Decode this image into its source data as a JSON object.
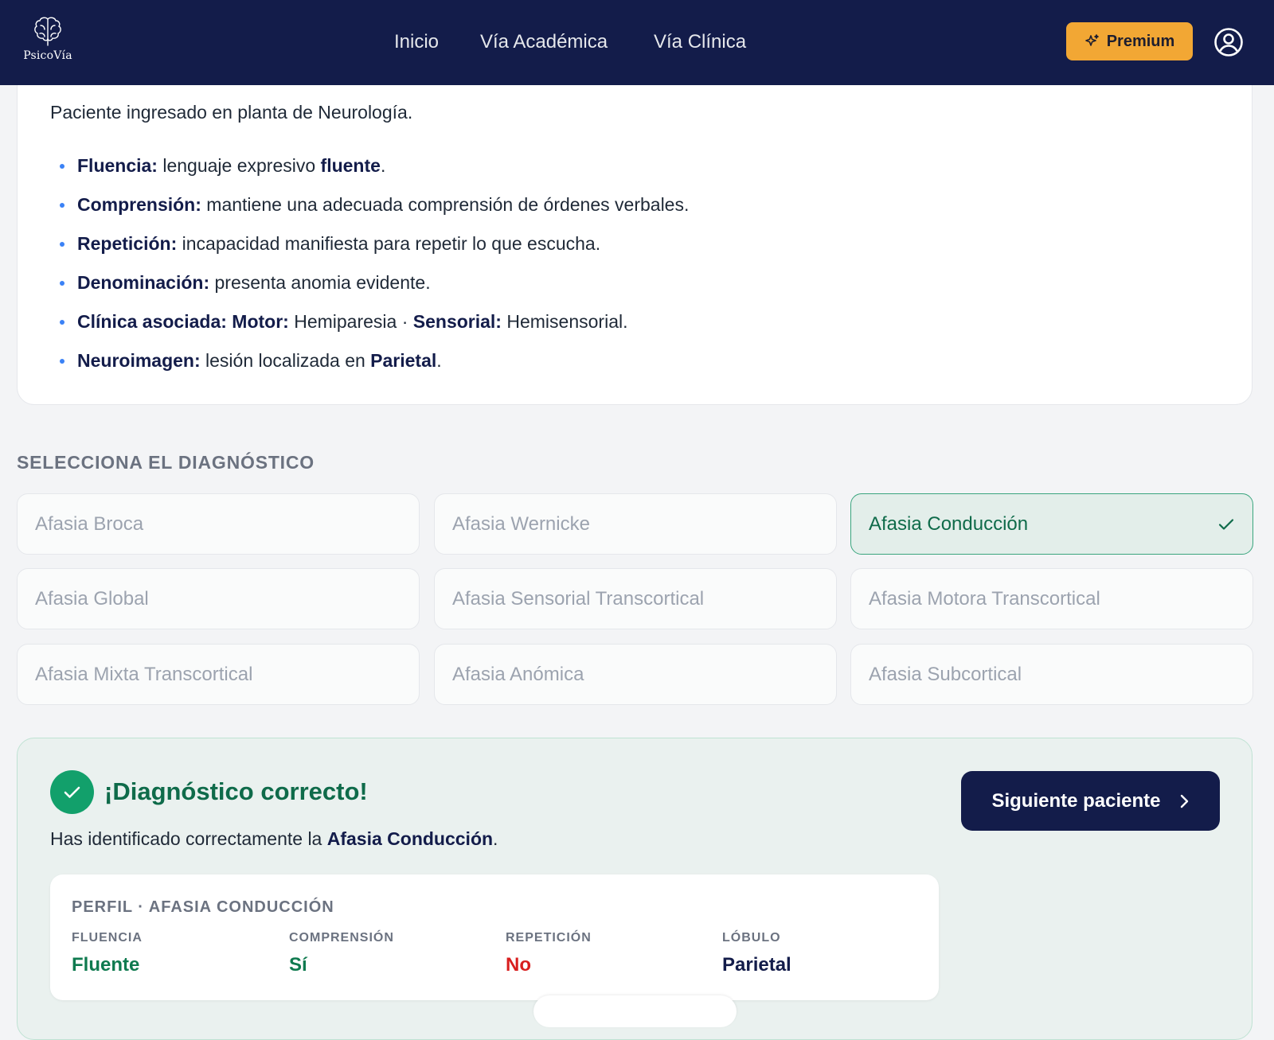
{
  "header": {
    "logo_text": "PsicoVía",
    "nav": [
      "Inicio",
      "Vía Académica",
      "Vía Clínica"
    ],
    "premium_label": "Premium"
  },
  "case": {
    "intro": "Paciente ingresado en planta de Neurología.",
    "items": [
      {
        "label": "Fluencia:",
        "text": " lenguaje expresivo ",
        "strong": "fluente",
        "tail": "."
      },
      {
        "label": "Comprensión:",
        "text": " mantiene una adecuada comprensión de órdenes verbales."
      },
      {
        "label": "Repetición:",
        "text": " incapacidad manifiesta para repetir lo que escucha."
      },
      {
        "label": "Denominación:",
        "text": " presenta anomia evidente."
      },
      {
        "label": "Clínica asociada: Motor:",
        "text": " Hemiparesia · ",
        "strong": "Sensorial:",
        "tail": " Hemisensorial."
      },
      {
        "label": "Neuroimagen:",
        "text": " lesión localizada en ",
        "strong": "Parietal",
        "tail": "."
      }
    ]
  },
  "selection": {
    "label": "SELECCIONA EL DIAGNÓSTICO",
    "options": [
      "Afasia Broca",
      "Afasia Wernicke",
      "Afasia Conducción",
      "Afasia Global",
      "Afasia Sensorial Transcortical",
      "Afasia Motora Transcortical",
      "Afasia Mixta Transcortical",
      "Afasia Anómica",
      "Afasia Subcortical"
    ],
    "selected_index": 2
  },
  "result": {
    "title": "¡Diagnóstico correcto!",
    "msg_prefix": "Has identificado correctamente la ",
    "msg_strong": "Afasia Conducción",
    "msg_suffix": ".",
    "next_label": "Siguiente paciente",
    "profile_title": "PERFIL · AFASIA CONDUCCIÓN",
    "metrics": [
      {
        "label": "FLUENCIA",
        "value": "Fluente",
        "color": "#0f7a4f"
      },
      {
        "label": "COMPRENSIÓN",
        "value": "Sí",
        "color": "#0f7a4f"
      },
      {
        "label": "REPETICIÓN",
        "value": "No",
        "color": "#d81e1e"
      },
      {
        "label": "LÓBULO",
        "value": "Parietal",
        "color": "#131c4a"
      }
    ]
  },
  "colors": {
    "navy": "#131c4a",
    "premium": "#f2a734",
    "success": "#12a06b",
    "error": "#d81e1e"
  }
}
